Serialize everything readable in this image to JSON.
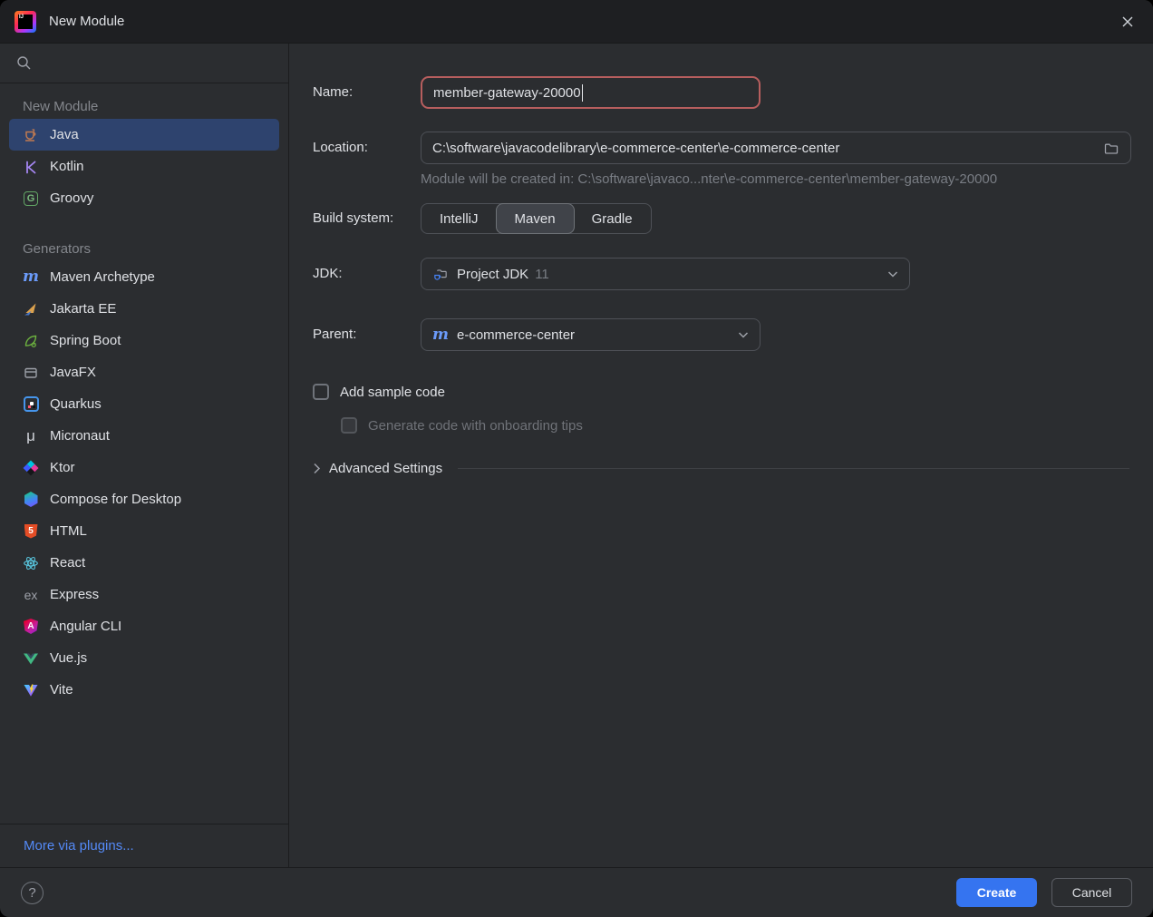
{
  "titlebar": {
    "title": "New Module"
  },
  "sidebar": {
    "sections": [
      {
        "header": "New Module",
        "items": [
          {
            "label": "Java",
            "icon": "java-icon",
            "selected": true
          },
          {
            "label": "Kotlin",
            "icon": "kotlin-icon",
            "selected": false
          },
          {
            "label": "Groovy",
            "icon": "groovy-icon",
            "selected": false
          }
        ]
      },
      {
        "header": "Generators",
        "items": [
          {
            "label": "Maven Archetype",
            "icon": "maven-archetype-icon"
          },
          {
            "label": "Jakarta EE",
            "icon": "jakarta-ee-icon"
          },
          {
            "label": "Spring Boot",
            "icon": "spring-boot-icon"
          },
          {
            "label": "JavaFX",
            "icon": "javafx-icon"
          },
          {
            "label": "Quarkus",
            "icon": "quarkus-icon"
          },
          {
            "label": "Micronaut",
            "icon": "micronaut-icon"
          },
          {
            "label": "Ktor",
            "icon": "ktor-icon"
          },
          {
            "label": "Compose for Desktop",
            "icon": "compose-icon"
          },
          {
            "label": "HTML",
            "icon": "html5-icon"
          },
          {
            "label": "React",
            "icon": "react-icon"
          },
          {
            "label": "Express",
            "icon": "express-icon"
          },
          {
            "label": "Angular CLI",
            "icon": "angular-icon"
          },
          {
            "label": "Vue.js",
            "icon": "vuejs-icon"
          },
          {
            "label": "Vite",
            "icon": "vite-icon"
          }
        ]
      }
    ],
    "more_link": "More via plugins..."
  },
  "form": {
    "name": {
      "label": "Name:",
      "value": "member-gateway-20000"
    },
    "location": {
      "label": "Location:",
      "value": "C:\\software\\javacodelibrary\\e-commerce-center\\e-commerce-center",
      "hint": "Module will be created in: C:\\software\\javaco...nter\\e-commerce-center\\member-gateway-20000"
    },
    "build_system": {
      "label": "Build system:",
      "options": [
        "IntelliJ",
        "Maven",
        "Gradle"
      ],
      "selected": "Maven"
    },
    "jdk": {
      "label": "JDK:",
      "value": "Project JDK",
      "version": "11"
    },
    "parent": {
      "label": "Parent:",
      "value": "e-commerce-center"
    },
    "add_sample_code": {
      "label": "Add sample code",
      "checked": false
    },
    "onboarding_tips": {
      "label": "Generate code with onboarding tips",
      "checked": false,
      "disabled": true
    },
    "advanced_settings": {
      "label": "Advanced Settings"
    }
  },
  "footer": {
    "create_label": "Create",
    "cancel_label": "Cancel"
  },
  "icons": {
    "idea_letters": "IJ",
    "groovy_glyph": "G",
    "maven_glyph": "m",
    "micronaut_glyph": "μ",
    "express_glyph": "ex",
    "html5_glyph": "5",
    "angular_glyph": "A",
    "help_glyph": "?"
  },
  "colors": {
    "accent": "#3574F0",
    "selection": "#2E436E",
    "error_border": "#B75E5E",
    "link": "#548AF7",
    "background": "#2B2D30",
    "titlebar": "#1E1F22"
  }
}
